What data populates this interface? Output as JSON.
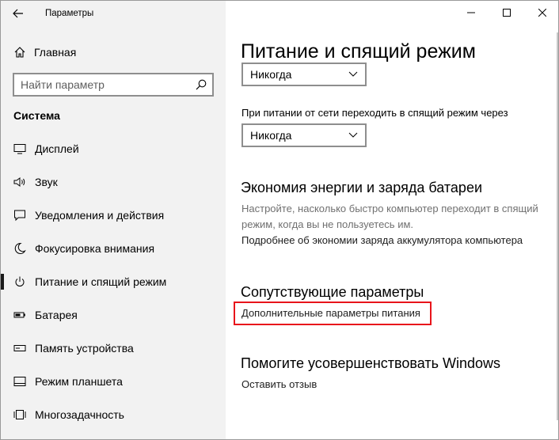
{
  "window": {
    "title": "Параметры"
  },
  "sidebar": {
    "home_label": "Главная",
    "search_placeholder": "Найти параметр",
    "section_title": "Система",
    "items": [
      {
        "label": "Дисплей",
        "icon": "monitor-icon"
      },
      {
        "label": "Звук",
        "icon": "speaker-icon"
      },
      {
        "label": "Уведомления и действия",
        "icon": "notification-icon"
      },
      {
        "label": "Фокусировка внимания",
        "icon": "moon-icon"
      },
      {
        "label": "Питание и спящий режим",
        "icon": "power-icon",
        "selected": true
      },
      {
        "label": "Батарея",
        "icon": "battery-icon"
      },
      {
        "label": "Память устройства",
        "icon": "storage-icon"
      },
      {
        "label": "Режим планшета",
        "icon": "tablet-icon"
      },
      {
        "label": "Многозадачность",
        "icon": "multitasking-icon"
      }
    ]
  },
  "main": {
    "page_title": "Питание и спящий режим",
    "dropdown1_value": "Никогда",
    "sleep_label": "При питании от сети переходить в спящий режим через",
    "dropdown2_value": "Никогда",
    "battery_saver_title": "Экономия энергии и заряда батареи",
    "battery_saver_desc": "Настройте, насколько быстро компьютер переходит в спящий режим, когда вы не пользуетесь им.",
    "battery_saver_link": "Подробнее об экономии заряда аккумулятора компьютера",
    "related_title": "Сопутствующие параметры",
    "related_link": "Дополнительные параметры питания",
    "improve_title": "Помогите усовершенствовать Windows",
    "feedback_link": "Оставить отзыв"
  },
  "colors": {
    "sidebar_bg": "#f2f2f2",
    "highlight": "#e8141b",
    "muted_text": "#707070"
  }
}
